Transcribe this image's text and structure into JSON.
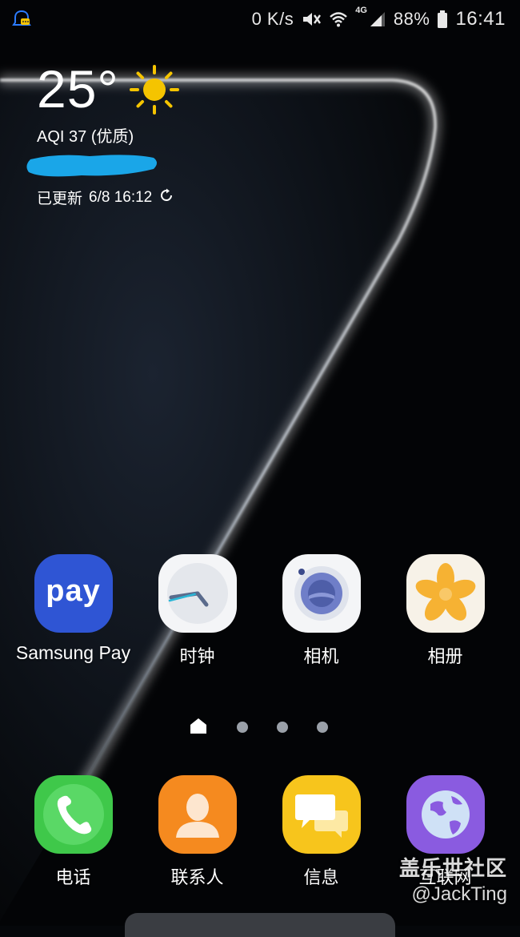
{
  "status_bar": {
    "speed": "0 K/s",
    "network_type": "4G",
    "battery": "88%",
    "time": "16:41",
    "icons": [
      "notification-app-icon",
      "mute-icon",
      "wifi-icon",
      "signal-icon",
      "battery-icon"
    ]
  },
  "weather": {
    "temperature": "25°",
    "condition_icon": "sun-icon",
    "aqi": "AQI 37 (优质)",
    "updated": "已更新",
    "updated_time": "6/8  16:12"
  },
  "apps_row1": [
    {
      "label": "Samsung Pay",
      "icon": "samsung-pay-icon",
      "icon_text": "pay"
    },
    {
      "label": "时钟",
      "icon": "clock-icon"
    },
    {
      "label": "相机",
      "icon": "camera-icon"
    },
    {
      "label": "相册",
      "icon": "gallery-icon"
    }
  ],
  "dock": [
    {
      "label": "电话",
      "icon": "phone-icon"
    },
    {
      "label": "联系人",
      "icon": "contacts-icon"
    },
    {
      "label": "信息",
      "icon": "messages-icon"
    },
    {
      "label": "互联网",
      "icon": "internet-icon"
    }
  ],
  "page_indicator": {
    "pages": 4,
    "current": 1
  },
  "watermark": {
    "title": "盖乐世社区",
    "handle": "@JackTing"
  },
  "colors": {
    "samsung_pay": "#2f55d4",
    "phone": "#3fc84a",
    "contacts": "#f58a1f",
    "messages": "#f7c51c",
    "internet": "#8a5be0",
    "sun": "#f5c400",
    "redaction": "#1aa6e8"
  }
}
